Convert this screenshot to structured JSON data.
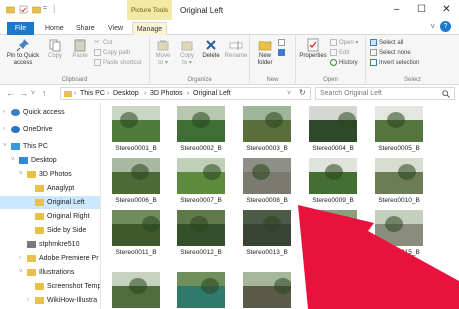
{
  "title_bar": {
    "picture_tools": "Picture Tools",
    "window_title": "Original Left"
  },
  "tabs": {
    "file": "File",
    "home": "Home",
    "share": "Share",
    "view": "View",
    "manage": "Manage"
  },
  "ribbon": {
    "clipboard": {
      "label": "Clipboard",
      "pin_line1": "Pin to Quick",
      "pin_line2": "access",
      "copy": "Copy",
      "paste": "Paste",
      "cut": "Cut",
      "copy_path": "Copy path",
      "paste_shortcut": "Paste shortcut"
    },
    "organize": {
      "label": "Organize",
      "move_to_1": "Move",
      "move_to_2": "to ▾",
      "copy_to_1": "Copy",
      "copy_to_2": "to ▾",
      "delete": "Delete",
      "rename": "Rename"
    },
    "new": {
      "label": "New",
      "new_folder_1": "New",
      "new_folder_2": "folder"
    },
    "open": {
      "label": "Open",
      "properties": "Properties",
      "open": "Open ▾",
      "edit": "Edit",
      "history": "History"
    },
    "select": {
      "label": "Select",
      "select_all": "Select all",
      "select_none": "Select none",
      "invert_selection": "Invert selection"
    }
  },
  "address": {
    "crumbs": [
      "This PC",
      "Desktop",
      "3D Photos",
      "Original Left"
    ],
    "search_placeholder": "Search Original Left"
  },
  "nav_pane": {
    "items": [
      {
        "label": "Quick access",
        "icon": "star-icon"
      },
      {
        "label": "OneDrive",
        "icon": "cloud-icon"
      },
      {
        "label": "This PC",
        "icon": "computer-icon"
      },
      {
        "label": "Desktop",
        "icon": "desktop-icon"
      },
      {
        "label": "3D Photos",
        "icon": "folder-icon"
      },
      {
        "label": "Anaglypt",
        "icon": "folder-icon"
      },
      {
        "label": "Original Left",
        "icon": "folder-icon",
        "selected": true
      },
      {
        "label": "Original Right",
        "icon": "folder-icon"
      },
      {
        "label": "Side by Side",
        "icon": "folder-icon"
      },
      {
        "label": "stphmkre510",
        "icon": "file-icon"
      },
      {
        "label": "Adobe Premiere Pr",
        "icon": "folder-icon"
      },
      {
        "label": "Illustrations",
        "icon": "folder-icon"
      },
      {
        "label": "Screenshot Temp",
        "icon": "folder-icon"
      },
      {
        "label": "WikiHow-Illustra",
        "icon": "folder-icon"
      },
      {
        "label": "3D Images Usin",
        "icon": "folder-icon"
      }
    ]
  },
  "files": [
    {
      "name": "Stereo0001_B",
      "sky": "#c9d6c4",
      "ground": "#4e7a3a"
    },
    {
      "name": "Stereo0002_B",
      "sky": "#b8c8b0",
      "ground": "#3f6e35"
    },
    {
      "name": "Stereo0003_B",
      "sky": "#9fb59a",
      "ground": "#5a6e3c"
    },
    {
      "name": "Stereo0004_B",
      "sky": "#d5d8d2",
      "ground": "#2f4a2a"
    },
    {
      "name": "Stereo0005_B",
      "sky": "#e4e6e2",
      "ground": "#55753f"
    },
    {
      "name": "Stereo0006_B",
      "sky": "#a9b9a0",
      "ground": "#4c6a36"
    },
    {
      "name": "Stereo0007_B",
      "sky": "#c2cfb8",
      "ground": "#5e8a3e"
    },
    {
      "name": "Stereo0008_B",
      "sky": "#8e8f86",
      "ground": "#7a7a70"
    },
    {
      "name": "Stereo0009_B",
      "sky": "#dfe3dc",
      "ground": "#436e32"
    },
    {
      "name": "Stereo0010_B",
      "sky": "#d7ddd0",
      "ground": "#6c7c55"
    },
    {
      "name": "Stereo0011_B",
      "sky": "#6e8c5c",
      "ground": "#3e5a2c"
    },
    {
      "name": "Stereo0012_B",
      "sky": "#5f7a4a",
      "ground": "#34502a"
    },
    {
      "name": "Stereo0013_B",
      "sky": "#4e5a48",
      "ground": "#3a4434"
    },
    {
      "name": "Stereo0014_B",
      "sky": "#8aa07a",
      "ground": "#496a3a"
    },
    {
      "name": "Stereo0015_B",
      "sky": "#c5cfbd",
      "ground": "#8a8c7c"
    },
    {
      "name": "",
      "sky": "#c9d2c0",
      "ground": "#4f6c3c"
    },
    {
      "name": "",
      "sky": "#6f8f5c",
      "ground": "#2f7a6a"
    },
    {
      "name": "",
      "sky": "#a7b79c",
      "ground": "#5a5a48"
    },
    {
      "name": "",
      "sky": "#7c8f6c",
      "ground": "#3e5a30"
    },
    {
      "name": "",
      "sky": "#cfd6c8",
      "ground": "#556a44"
    }
  ],
  "colors": {
    "accent": "#1979ca",
    "selection": "#cce8ff",
    "folder": "#e8c04a",
    "arrow": "#e8123c"
  }
}
